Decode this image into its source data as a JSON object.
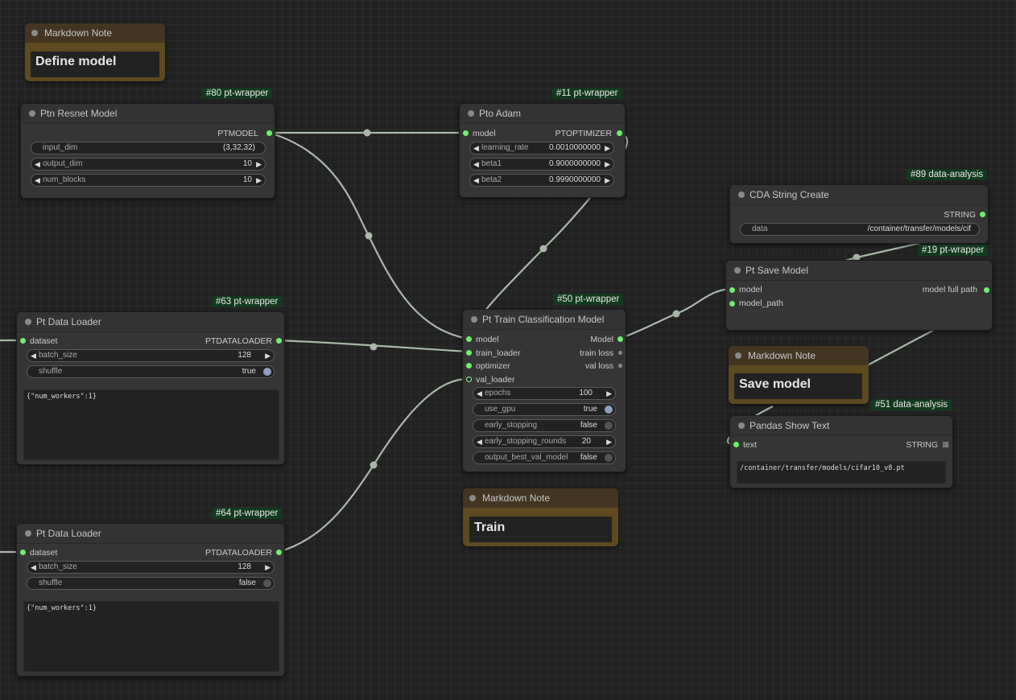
{
  "notes": {
    "define": {
      "title": "Markdown Note",
      "text": "Define model"
    },
    "train": {
      "title": "Markdown Note",
      "text": "Train"
    },
    "save": {
      "title": "Markdown Note",
      "text": "Save model"
    }
  },
  "resnet": {
    "badge": "#80 pt-wrapper",
    "title": "Ptn Resnet Model",
    "output": "PTMODEL",
    "input_dim_label": "input_dim",
    "input_dim_value": "(3,32,32)",
    "output_dim_label": "output_dim",
    "output_dim_value": "10",
    "num_blocks_label": "num_blocks",
    "num_blocks_value": "10"
  },
  "adam": {
    "badge": "#11 pt-wrapper",
    "title": "Pto Adam",
    "input": "model",
    "output": "PTOPTIMIZER",
    "lr_label": "learning_rate",
    "lr_value": "0.0010000000",
    "beta1_label": "beta1",
    "beta1_value": "0.9000000000",
    "beta2_label": "beta2",
    "beta2_value": "0.9990000000"
  },
  "loader63": {
    "badge": "#63 pt-wrapper",
    "title": "Pt Data Loader",
    "input": "dataset",
    "output": "PTDATALOADER",
    "batch_label": "batch_size",
    "batch_value": "128",
    "shuffle_label": "shuffle",
    "shuffle_value": "true",
    "text": "{\"num_workers\":1}"
  },
  "loader64": {
    "badge": "#64 pt-wrapper",
    "title": "Pt Data Loader",
    "input": "dataset",
    "output": "PTDATALOADER",
    "batch_label": "batch_size",
    "batch_value": "128",
    "shuffle_label": "shuffle",
    "shuffle_value": "false",
    "text": "{\"num_workers\":1}"
  },
  "train": {
    "badge": "#50 pt-wrapper",
    "title": "Pt Train Classification Model",
    "in_model": "model",
    "in_train_loader": "train_loader",
    "in_optimizer": "optimizer",
    "in_val_loader": "val_loader",
    "out_model": "Model",
    "out_train_loss": "train loss",
    "out_val_loss": "val loss",
    "epochs_label": "epochs",
    "epochs_value": "100",
    "use_gpu_label": "use_gpu",
    "use_gpu_value": "true",
    "early_stopping_label": "early_stopping",
    "early_stopping_value": "false",
    "rounds_label": "early_stopping_rounds",
    "rounds_value": "20",
    "best_label": "output_best_val_model",
    "best_value": "false"
  },
  "cda": {
    "badge": "#89 data-analysis",
    "title": "CDA String Create",
    "output": "STRING",
    "data_label": "data",
    "data_value": "/container/transfer/models/cif"
  },
  "save": {
    "badge": "#19 pt-wrapper",
    "title": "Pt Save Model",
    "in_model": "model",
    "in_path": "model_path",
    "output": "model full path"
  },
  "pandas": {
    "badge": "#51 data-analysis",
    "title": "Pandas Show Text",
    "input": "text",
    "output": "STRING",
    "text": "/container/transfer/models/cifar10_v8.pt"
  },
  "colors": {
    "wire": "#a8b8a8",
    "port": "#6ef06e",
    "badge_bg": "#123a1e",
    "note_bg": "#5e4a1f"
  }
}
